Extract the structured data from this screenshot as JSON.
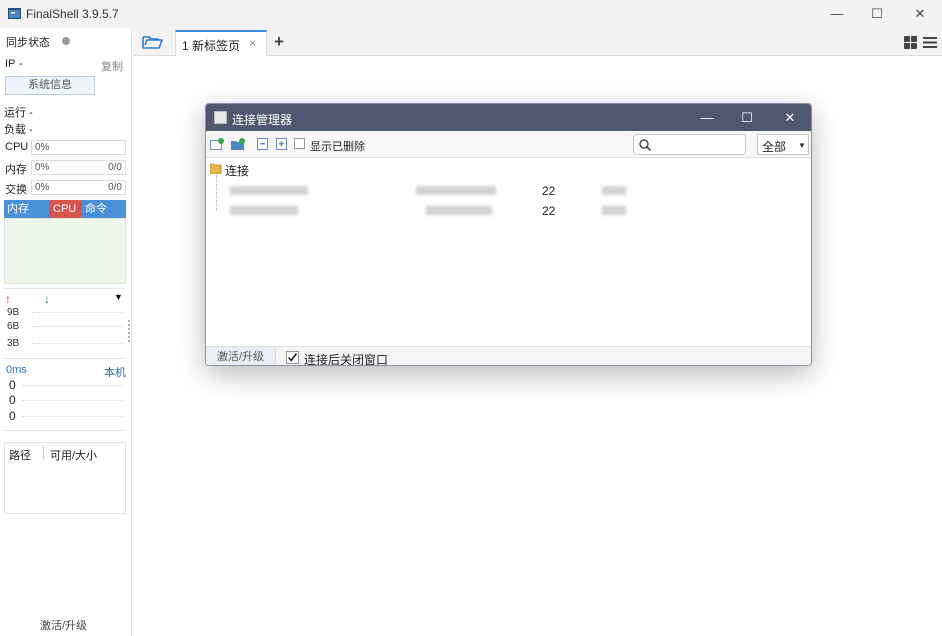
{
  "window": {
    "title": "FinalShell 3.9.5.7",
    "controls": [
      "—",
      "☐",
      "✕"
    ]
  },
  "left_panel": {
    "sync_label": "同步状态",
    "ip_label": "IP",
    "ip_value": "-",
    "copy_label": "复制",
    "sysinfo_button": "系统信息",
    "run_label": "运行 -",
    "load_label": "负载 -",
    "cpu_label": "CPU",
    "cpu_value": "0%",
    "mem_label": "内存",
    "mem_value": "0%",
    "mem_ratio": "0/0",
    "swap_label": "交换",
    "swap_value": "0%",
    "swap_ratio": "0/0",
    "proc_tabs": [
      "内存",
      "CPU",
      "命令"
    ],
    "net_up_arrow": "↑",
    "net_down_arrow": "↓",
    "net_menu_arrow": "▼",
    "net_scale": [
      "9B",
      "6B",
      "3B"
    ],
    "ping_label": "0ms",
    "ping_host": "本机",
    "ping_values": [
      "0",
      "0",
      "0"
    ],
    "disk_col_path": "路径",
    "disk_col_size": "可用/大小",
    "activate_label": "激活/升级"
  },
  "tabbar": {
    "folder_icon": "folder-open-icon",
    "active_tab": "1 新标签页",
    "close_glyph": "×",
    "add_glyph": "+"
  },
  "dialog": {
    "title": "连接管理器",
    "show_deleted_label": "显示已删除",
    "search_placeholder": "",
    "filter_value": "全部",
    "root_folder": "连接",
    "rows": [
      {
        "port": "22"
      },
      {
        "port": "22"
      }
    ],
    "footer_activate": "激活/升级",
    "close_after_connect_label": "连接后关闭窗口"
  },
  "colors": {
    "accent": "#3d8ee0",
    "dialog_title_bg": "#4f586f",
    "proc_tab_mem": "#4a90d9",
    "proc_tab_cpu": "#d9534f",
    "proc_tab_cmd": "#4a90d9"
  }
}
